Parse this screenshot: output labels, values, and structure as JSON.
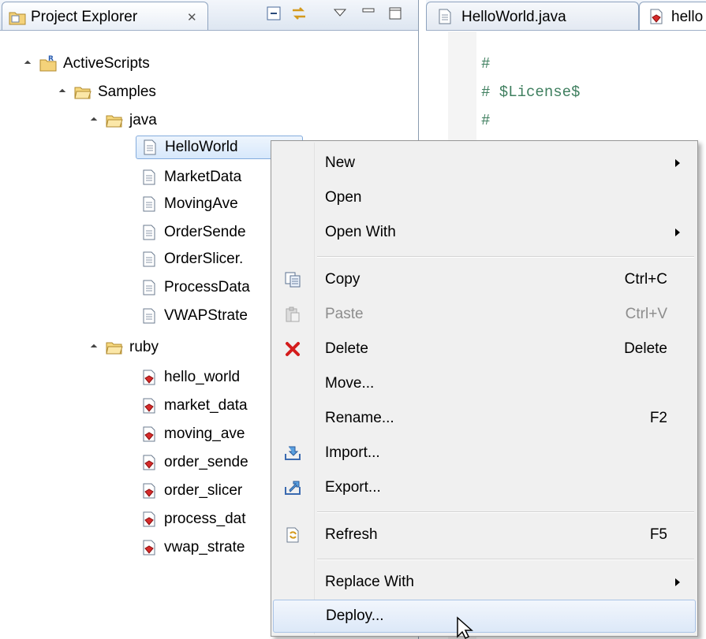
{
  "explorer": {
    "title": "Project Explorer",
    "close_glyph": "✕",
    "tree": [
      {
        "label": "ActiveScripts",
        "icon": "project-icon"
      },
      {
        "label": "Samples",
        "icon": "folder-icon"
      },
      {
        "label": "java",
        "icon": "folder-icon"
      },
      {
        "label": "HelloWorld",
        "icon": "java-file-icon"
      },
      {
        "label": "MarketData",
        "icon": "java-file-icon"
      },
      {
        "label": "MovingAve",
        "icon": "java-file-icon"
      },
      {
        "label": "OrderSende",
        "icon": "java-file-icon"
      },
      {
        "label": "OrderSlicer.",
        "icon": "java-file-icon"
      },
      {
        "label": "ProcessData",
        "icon": "java-file-icon"
      },
      {
        "label": "VWAPStrate",
        "icon": "java-file-icon"
      },
      {
        "label": "ruby",
        "icon": "folder-icon"
      },
      {
        "label": "hello_world",
        "icon": "ruby-file-icon"
      },
      {
        "label": "market_data",
        "icon": "ruby-file-icon"
      },
      {
        "label": "moving_ave",
        "icon": "ruby-file-icon"
      },
      {
        "label": "order_sende",
        "icon": "ruby-file-icon"
      },
      {
        "label": "order_slicer",
        "icon": "ruby-file-icon"
      },
      {
        "label": "process_dat",
        "icon": "ruby-file-icon"
      },
      {
        "label": "vwap_strate",
        "icon": "ruby-file-icon"
      }
    ]
  },
  "editor": {
    "tabs": [
      {
        "label": "HelloWorld.java"
      },
      {
        "label": "hello"
      }
    ],
    "code_lines": [
      "#",
      "# $License$",
      "#"
    ]
  },
  "context_menu": {
    "items": [
      {
        "label": "New",
        "shortcut": "",
        "submenu": true,
        "icon": ""
      },
      {
        "label": "Open",
        "shortcut": "",
        "submenu": false,
        "icon": ""
      },
      {
        "label": "Open With",
        "shortcut": "",
        "submenu": true,
        "icon": ""
      },
      {
        "label": "Copy",
        "shortcut": "Ctrl+C",
        "submenu": false,
        "icon": "copy-icon"
      },
      {
        "label": "Paste",
        "shortcut": "Ctrl+V",
        "submenu": false,
        "icon": "paste-icon",
        "disabled": true
      },
      {
        "label": "Delete",
        "shortcut": "Delete",
        "submenu": false,
        "icon": "delete-icon"
      },
      {
        "label": "Move...",
        "shortcut": "",
        "submenu": false,
        "icon": ""
      },
      {
        "label": "Rename...",
        "shortcut": "F2",
        "submenu": false,
        "icon": ""
      },
      {
        "label": "Import...",
        "shortcut": "",
        "submenu": false,
        "icon": "import-icon"
      },
      {
        "label": "Export...",
        "shortcut": "",
        "submenu": false,
        "icon": "export-icon"
      },
      {
        "label": "Refresh",
        "shortcut": "F5",
        "submenu": false,
        "icon": "refresh-icon"
      },
      {
        "label": "Replace With",
        "shortcut": "",
        "submenu": true,
        "icon": ""
      },
      {
        "label": "Deploy...",
        "shortcut": "",
        "submenu": false,
        "icon": "",
        "hovered": true
      }
    ]
  }
}
